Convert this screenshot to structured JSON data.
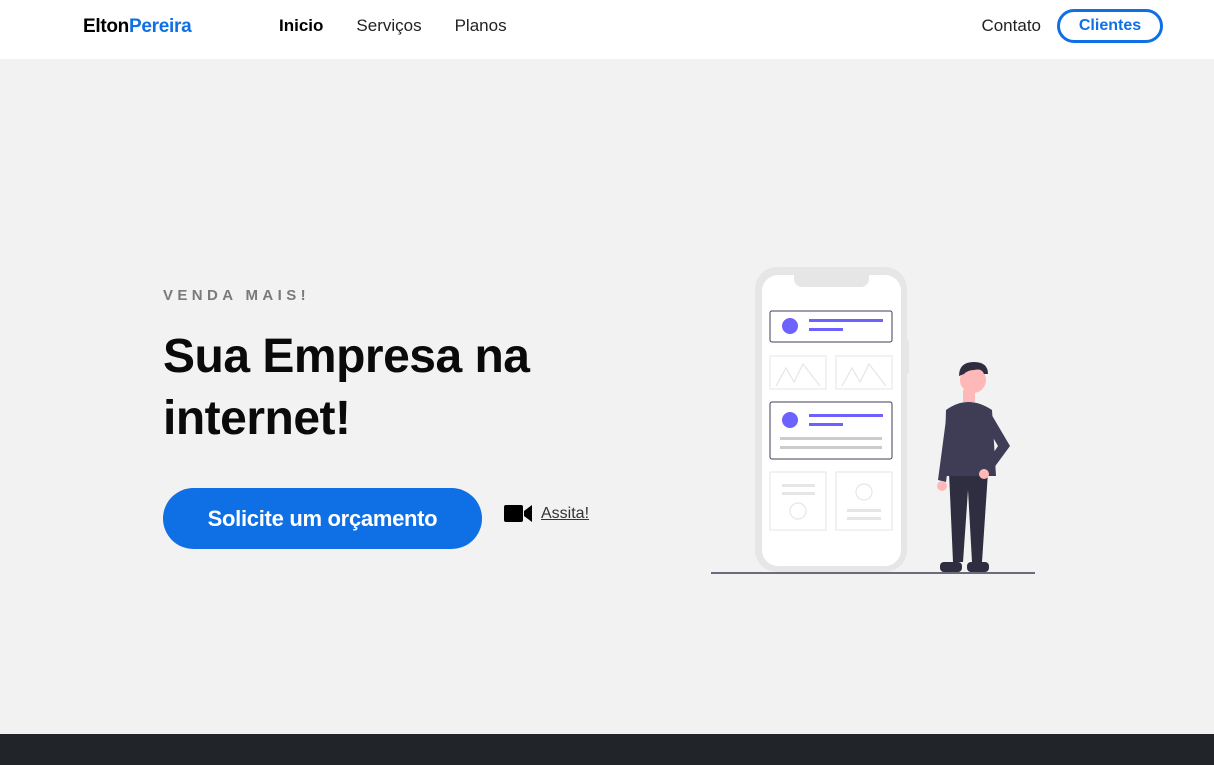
{
  "header": {
    "brand_first": "Elton",
    "brand_second": "Pereira",
    "nav": [
      {
        "label": "Inicio",
        "active": true
      },
      {
        "label": "Serviços",
        "active": false
      },
      {
        "label": "Planos",
        "active": false
      }
    ],
    "contact_label": "Contato",
    "clients_label": "Clientes"
  },
  "hero": {
    "eyebrow": "VENDA MAIS!",
    "title": "Sua Empresa na internet!",
    "cta_label": "Solicite um orçamento",
    "watch_label": "Assita!",
    "watch_icon": "video-camera-icon"
  },
  "colors": {
    "accent": "#0f70e6",
    "background": "#f2f2f2",
    "footer": "#212529",
    "illustration_purple": "#6c63ff",
    "figure_dark": "#2f2e41"
  }
}
